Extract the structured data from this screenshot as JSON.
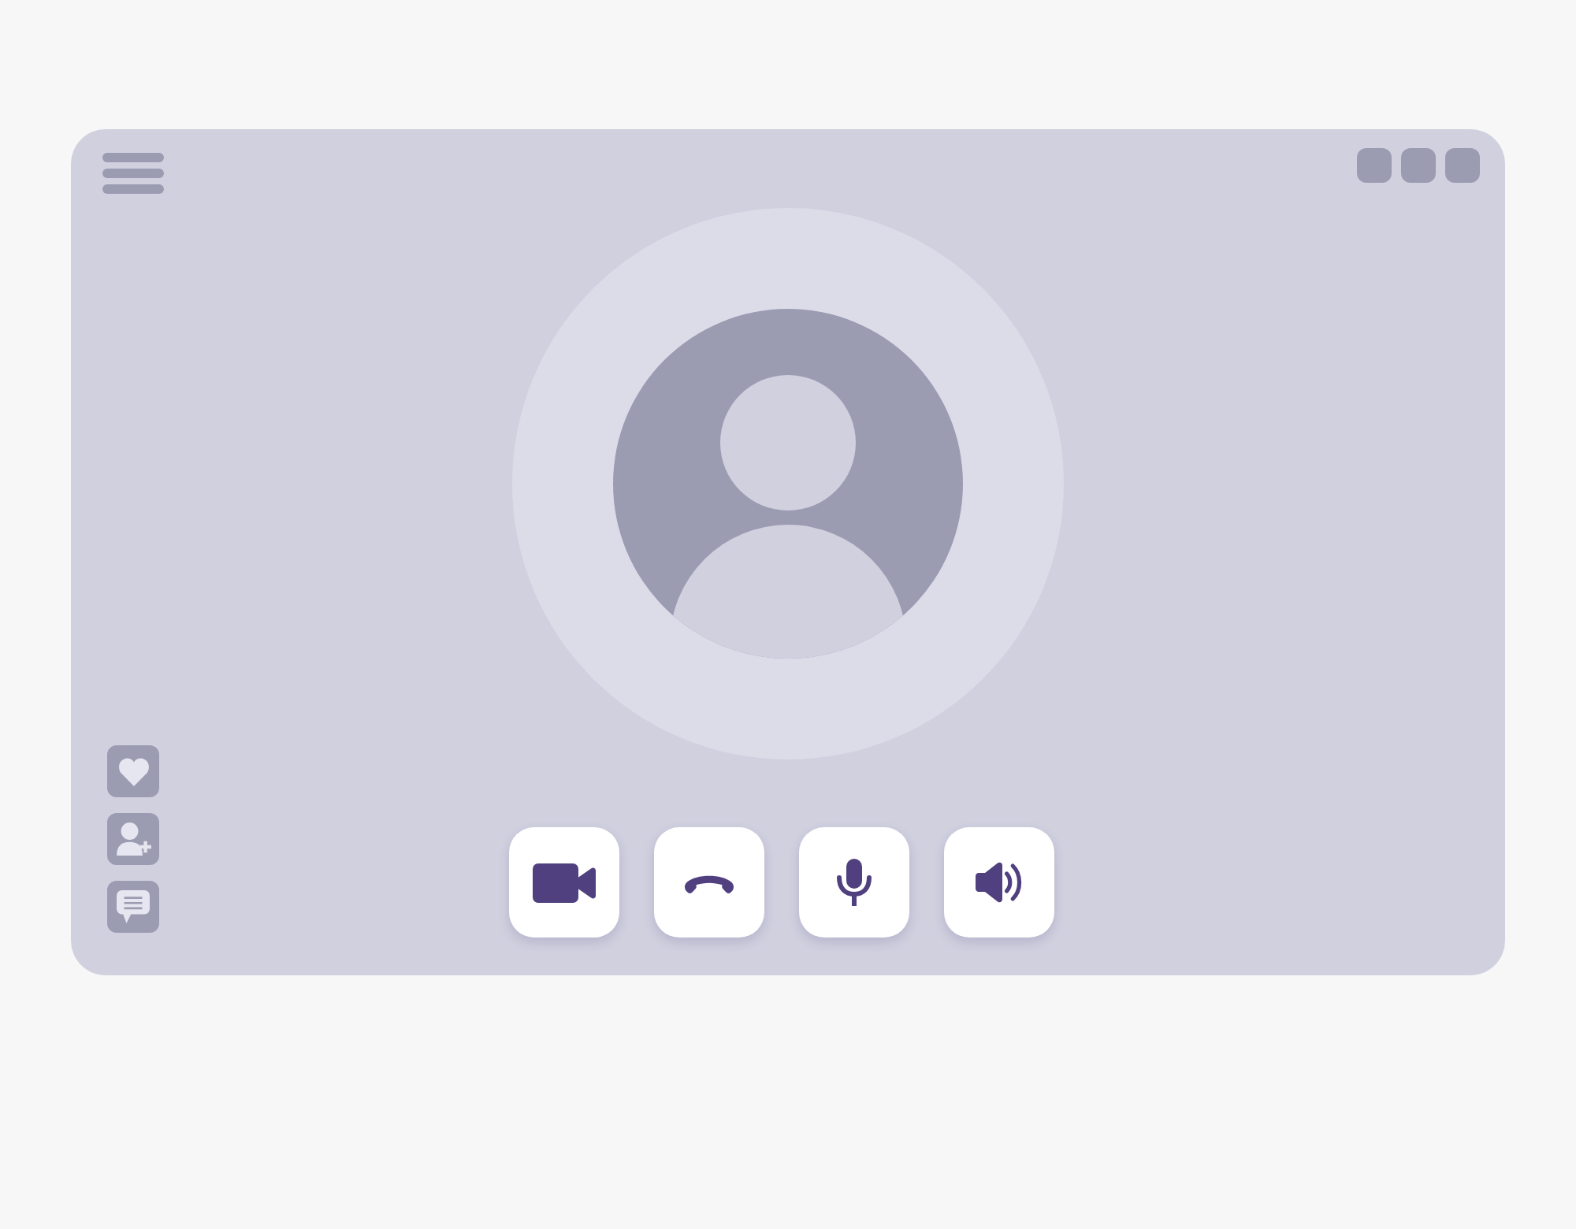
{
  "window": {
    "menu": {
      "kind": "hamburger"
    },
    "controls": [
      {
        "kind": "square"
      },
      {
        "kind": "square"
      },
      {
        "kind": "square"
      }
    ]
  },
  "call": {
    "avatar": {
      "kind": "silhouette"
    }
  },
  "side_actions": [
    {
      "kind": "heart"
    },
    {
      "kind": "add-user"
    },
    {
      "kind": "chat"
    }
  ],
  "call_controls": [
    {
      "kind": "camera"
    },
    {
      "kind": "hang-up"
    },
    {
      "kind": "microphone"
    },
    {
      "kind": "speaker"
    }
  ]
}
